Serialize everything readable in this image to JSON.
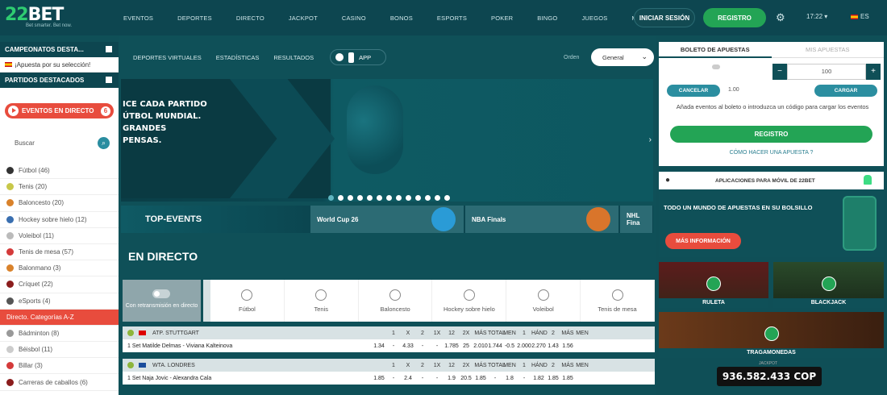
{
  "logo": {
    "text_a": "22",
    "text_b": "BET",
    "tagline": "Bet smarter. Bet now."
  },
  "topnav": [
    "Eventos",
    "Deportes",
    "Directo",
    "Jackpot",
    "Casino",
    "Bonos",
    "Esports",
    "Poker",
    "Bingo",
    "Juegos",
    "Más"
  ],
  "header": {
    "login": "INICIAR SESIÓN",
    "register": "REGISTRO",
    "time": "17:22",
    "lang": "ES"
  },
  "sidebar": {
    "sec1": "CAMPEONATOS DESTA...",
    "suggest": "¡Apuesta por su selección!",
    "sec2": "PARTIDOS DESTACADOS",
    "live": "EVENTOS EN DIRECTO",
    "live_count": "6",
    "search_placeholder": "Buscar",
    "sports": [
      {
        "label": "Fútbol (46)",
        "color": "#333333"
      },
      {
        "label": "Tenis (20)",
        "color": "#c8c84a"
      },
      {
        "label": "Baloncesto (20)",
        "color": "#d9822b"
      },
      {
        "label": "Hockey sobre hielo (12)",
        "color": "#3a6fb0"
      },
      {
        "label": "Voleibol (11)",
        "color": "#bbbbbb"
      },
      {
        "label": "Tenis de mesa (57)",
        "color": "#d43a3a"
      },
      {
        "label": "Balonmano (3)",
        "color": "#d9822b"
      },
      {
        "label": "Críquet (22)",
        "color": "#8b1d1d"
      },
      {
        "label": "eSports (4)",
        "color": "#555555"
      },
      {
        "label": "Directo. Categorías A-Z",
        "color": "",
        "red": true
      },
      {
        "label": "Bádminton (8)",
        "color": "#999999"
      },
      {
        "label": "Béisbol (11)",
        "color": "#cccccc"
      },
      {
        "label": "Billar (3)",
        "color": "#d43a3a"
      },
      {
        "label": "Carreras de caballos (6)",
        "color": "#8b1d1d"
      }
    ]
  },
  "subnav": {
    "virtual": "Deportes virtuales",
    "stats": "Estadísticas",
    "results": "Resultados",
    "app": "APP",
    "sort_label": "Orden",
    "sort_value": "General"
  },
  "banner": {
    "l1": "ICE CADA PARTIDO",
    "l2": "ÚTBOL MUNDIAL.",
    "l3": "GRANDES",
    "l4": "PENSAS."
  },
  "topevents": {
    "title": "TOP-EVENTS",
    "cards": [
      {
        "label": "World Cup 26",
        "color": "#2a9bd6"
      },
      {
        "label": "NBA Finals",
        "color": "#d9752b"
      },
      {
        "label": "NHL Fina",
        "color": "#2b5b9c"
      }
    ]
  },
  "live_title": "EN DIRECTO",
  "sportsbar": {
    "stream": "Con retransmisión en directo",
    "items": [
      "Fútbol",
      "Tenis",
      "Baloncesto",
      "Hockey sobre hielo",
      "Voleibol",
      "Tenis de mesa"
    ]
  },
  "matches": [
    {
      "league": "ATP. STUTTGART",
      "flag": "#d00",
      "players": "1 Set   Matilde Delmas - Viviana Kalteinova",
      "odds": [
        "1.34",
        "-",
        "4.33",
        "-",
        "-",
        "1.785",
        "25",
        "2.010",
        "1.744",
        "-0.5",
        "2.000",
        "2.270",
        "1.43",
        "1.56"
      ]
    },
    {
      "league": "WTA. LONDRES",
      "flag": "#1a4d9c",
      "players": "1 Set   Naja Jovic - Alexandra Cala",
      "odds": [
        "1.85",
        "-",
        "2.4",
        "-",
        "-",
        "1.9",
        "20.5",
        "1.85",
        "-",
        "1.8",
        "-",
        "1.82",
        "1.85",
        "1.85"
      ]
    }
  ],
  "odds_head": [
    "1",
    "X",
    "2",
    "1X",
    "12",
    "2X",
    "MÁS",
    "TOTAL",
    "MEN",
    "1",
    "HÁND",
    "2",
    "MÁS",
    "MEN"
  ],
  "slip": {
    "tab1": "Boleto de apuestas",
    "tab2": "Mis apuestas",
    "stake": "100",
    "cancel": "CANCELAR",
    "load": "CARGAR",
    "odds": "1.00",
    "msg": "Añada eventos al boleto o introduzca un código para cargar los eventos",
    "register": "REGISTRO",
    "how": "CÓMO HACER UNA APUESTA"
  },
  "appbox": {
    "title": "APLICACIONES PARA MÓVIL DE 22BET",
    "body": "TODO UN MUNDO DE APUESTAS EN SU BOLSILLO",
    "more": "MÁS INFORMACIÓN"
  },
  "games": {
    "roulette": "RULETA",
    "blackjack": "BLACKJACK",
    "slots": "TRAGAMONEDAS"
  },
  "jackpot": {
    "caption": "JACKPOT",
    "value": "936.582.433 COP"
  }
}
